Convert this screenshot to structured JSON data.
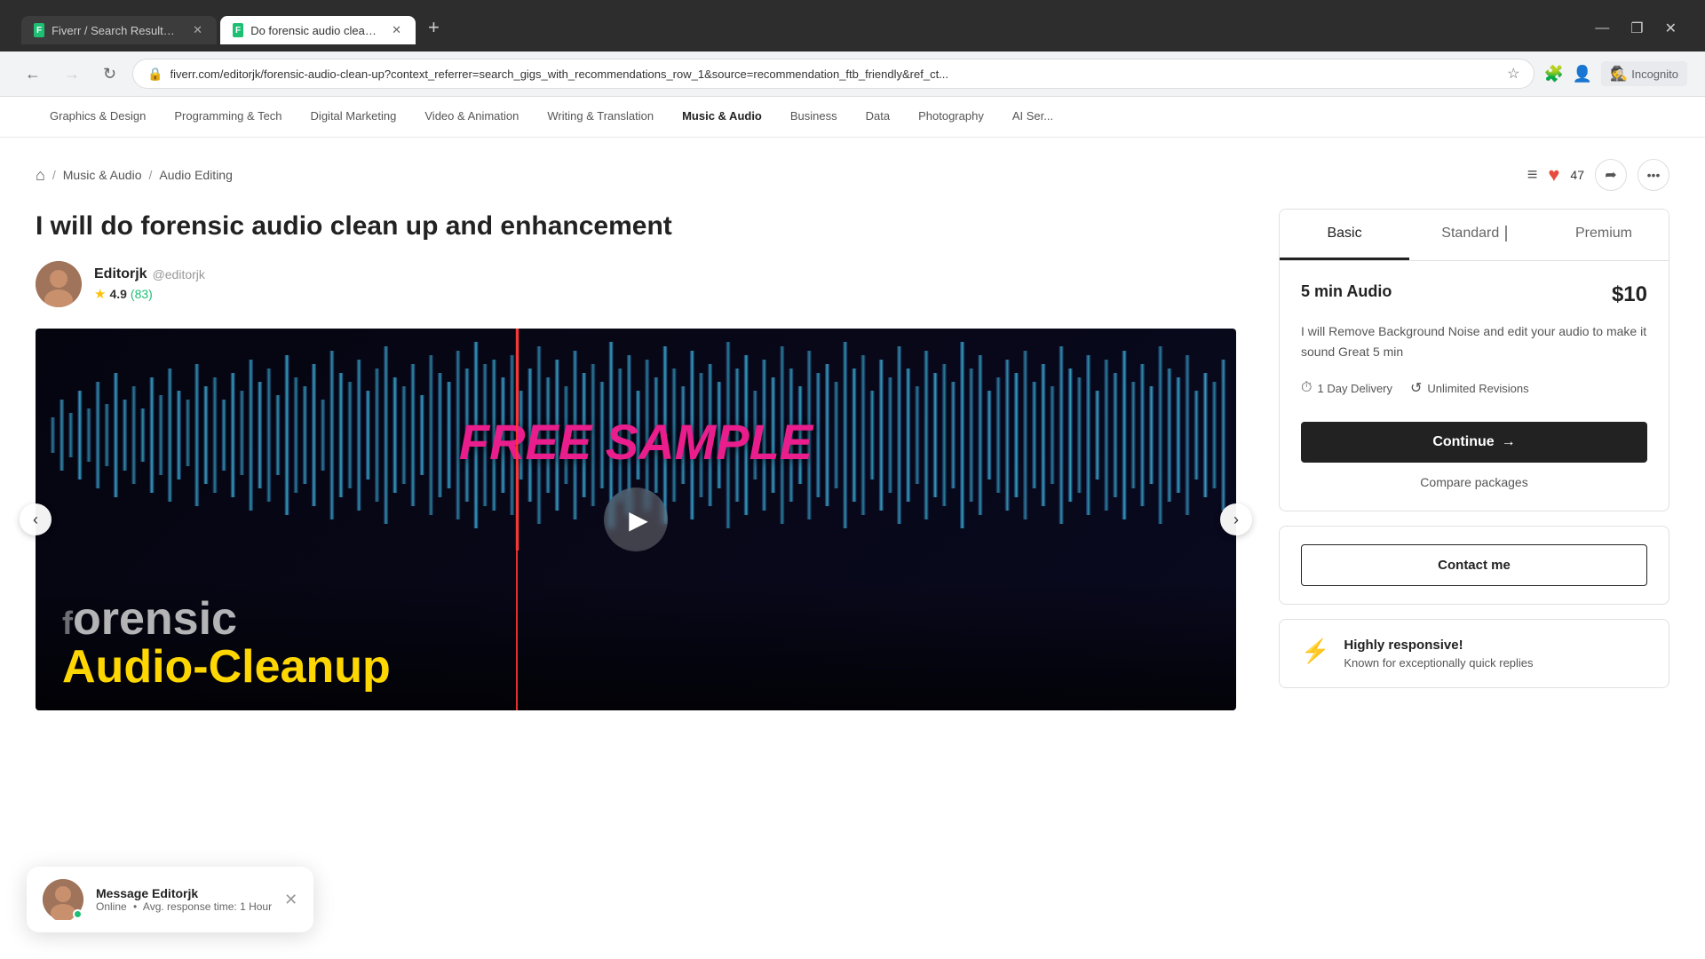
{
  "browser": {
    "tabs": [
      {
        "id": "tab1",
        "favicon": "F",
        "title": "Fiverr / Search Results for 'audi...",
        "active": false
      },
      {
        "id": "tab2",
        "favicon": "F",
        "title": "Do forensic audio clean up and...",
        "active": true
      }
    ],
    "new_tab_label": "+",
    "address": "fiverr.com/editorjk/forensic-audio-clean-up?context_referrer=search_gigs_with_recommendations_row_1&source=recommendation_ftb_friendly&ref_ct...",
    "incognito_label": "Incognito",
    "nav_back": "←",
    "nav_forward": "→",
    "nav_refresh": "↻",
    "win_min": "—",
    "win_max": "❐",
    "win_close": "✕"
  },
  "categories": [
    "Graphics & Design",
    "Programming & Tech",
    "Digital Marketing",
    "Video & Animation",
    "Writing & Translation",
    "Music & Audio",
    "Business",
    "Data",
    "Photography",
    "AI Ser..."
  ],
  "breadcrumb": {
    "home_icon": "⌂",
    "music_label": "Music & Audio",
    "editing_label": "Audio Editing"
  },
  "actions": {
    "list_icon": "≡",
    "heart_icon": "♥",
    "like_count": "47",
    "share_icon": "⎋",
    "more_icon": "···"
  },
  "gig": {
    "title": "I will do forensic audio clean up and enhancement",
    "seller": {
      "name": "Editorjk",
      "handle": "@editorjk",
      "rating": "4.9",
      "review_count": "(83)"
    },
    "image": {
      "free_sample_text": "FREE SAMPLE",
      "overlay_text1": "orensic",
      "overlay_text2": "Audio-Cleanup",
      "play_label": "▶"
    },
    "gallery_prev": "‹",
    "gallery_next": "›"
  },
  "pricing": {
    "tabs": [
      {
        "id": "basic",
        "label": "Basic",
        "active": true
      },
      {
        "id": "standard",
        "label": "Standard",
        "active": false
      },
      {
        "id": "premium",
        "label": "Premium",
        "active": false
      }
    ],
    "basic": {
      "tier_name": "5 min Audio",
      "price": "$10",
      "description": "I will Remove Background Noise and edit your audio to make it sound Great 5 min",
      "delivery": "1 Day Delivery",
      "revisions": "Unlimited Revisions",
      "delivery_icon": "⏱",
      "revisions_icon": "↺",
      "continue_label": "Continue",
      "continue_arrow": "→",
      "compare_label": "Compare packages"
    }
  },
  "contact": {
    "button_label": "Contact me"
  },
  "responsive": {
    "icon": "⚡",
    "title": "Highly responsive!",
    "description": "Known for exceptionally quick replies"
  },
  "message_bubble": {
    "name": "Message Editorjk",
    "status": "Online",
    "separator": "•",
    "avg_response": "Avg. response time: 1 Hour"
  }
}
